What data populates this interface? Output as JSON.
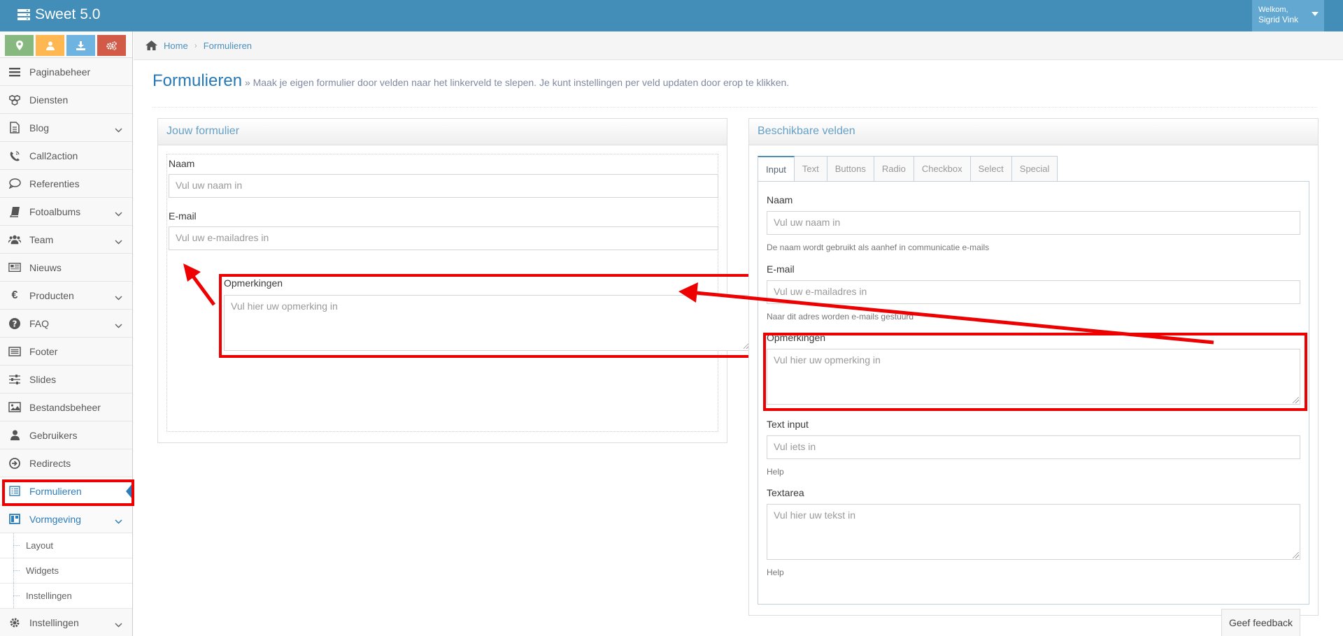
{
  "app": {
    "title": "Sweet 5.0"
  },
  "user": {
    "welcome": "Welkom,",
    "name": "Sigrid Vink"
  },
  "sidebar": {
    "shortcuts": [
      {
        "icon": "map-marker-icon",
        "color": "#87b87f"
      },
      {
        "icon": "user-icon",
        "color": "#ffb752"
      },
      {
        "icon": "download-icon",
        "color": "#6fb3e0"
      },
      {
        "icon": "cogs-icon",
        "color": "#d15b47"
      }
    ],
    "items": [
      {
        "label": "Paginabeheer",
        "icon": "bars-icon",
        "has_children": false
      },
      {
        "label": "Diensten",
        "icon": "cubes-icon",
        "has_children": false
      },
      {
        "label": "Blog",
        "icon": "file-text-icon",
        "has_children": true
      },
      {
        "label": "Call2action",
        "icon": "phone-volume-icon",
        "has_children": false
      },
      {
        "label": "Referenties",
        "icon": "comment-icon",
        "has_children": false
      },
      {
        "label": "Fotoalbums",
        "icon": "book-icon",
        "has_children": true
      },
      {
        "label": "Team",
        "icon": "users-icon",
        "has_children": true
      },
      {
        "label": "Nieuws",
        "icon": "newspaper-icon",
        "has_children": false
      },
      {
        "label": "Producten",
        "icon": "euro-icon",
        "has_children": true
      },
      {
        "label": "FAQ",
        "icon": "question-circle-icon",
        "has_children": true
      },
      {
        "label": "Footer",
        "icon": "list-alt-icon",
        "has_children": false
      },
      {
        "label": "Slides",
        "icon": "sliders-icon",
        "has_children": false
      },
      {
        "label": "Bestandsbeheer",
        "icon": "image-icon",
        "has_children": false
      },
      {
        "label": "Gebruikers",
        "icon": "user-icon",
        "has_children": false
      },
      {
        "label": "Redirects",
        "icon": "arrow-circle-right-icon",
        "has_children": false
      },
      {
        "label": "Formulieren",
        "icon": "form-icon",
        "has_children": false,
        "active": true
      },
      {
        "label": "Vormgeving",
        "icon": "columns-icon",
        "has_children": true,
        "open": true
      }
    ],
    "subitems": [
      {
        "label": "Layout"
      },
      {
        "label": "Widgets"
      },
      {
        "label": "Instellingen"
      }
    ],
    "last_item": {
      "label": "Instellingen",
      "icon": "gear-icon",
      "has_children": true
    }
  },
  "breadcrumb": {
    "home": "Home",
    "current": "Formulieren"
  },
  "page": {
    "title": "Formulieren",
    "description": "» Maak je eigen formulier door velden naar het linkerveld te slepen. Je kunt instellingen per veld updaten door erop te klikken."
  },
  "left_panel": {
    "title": "Jouw formulier",
    "fields": {
      "naam": {
        "label": "Naam",
        "placeholder": "Vul uw naam in"
      },
      "email": {
        "label": "E-mail",
        "placeholder": "Vul uw e-mailadres in"
      },
      "opmerkingen": {
        "label": "Opmerkingen",
        "placeholder": "Vul hier uw opmerking in"
      }
    }
  },
  "right_panel": {
    "title": "Beschikbare velden",
    "tabs": [
      "Input",
      "Text",
      "Buttons",
      "Radio",
      "Checkbox",
      "Select",
      "Special"
    ],
    "active_tab": "Input",
    "fields": {
      "naam": {
        "label": "Naam",
        "placeholder": "Vul uw naam in",
        "help": "De naam wordt gebruikt als aanhef in communicatie e-mails"
      },
      "email": {
        "label": "E-mail",
        "placeholder": "Vul uw e-mailadres in",
        "help": "Naar dit adres worden e-mails gestuurd"
      },
      "opmerkingen": {
        "label": "Opmerkingen",
        "placeholder": "Vul hier uw opmerking in"
      },
      "text_input": {
        "label": "Text input",
        "placeholder": "Vul iets in",
        "help": "Help"
      },
      "textarea": {
        "label": "Textarea",
        "placeholder": "Vul hier uw tekst in",
        "help": "Help"
      }
    }
  },
  "feedback": {
    "label": "Geef feedback"
  },
  "annotation_color": "#e00000"
}
